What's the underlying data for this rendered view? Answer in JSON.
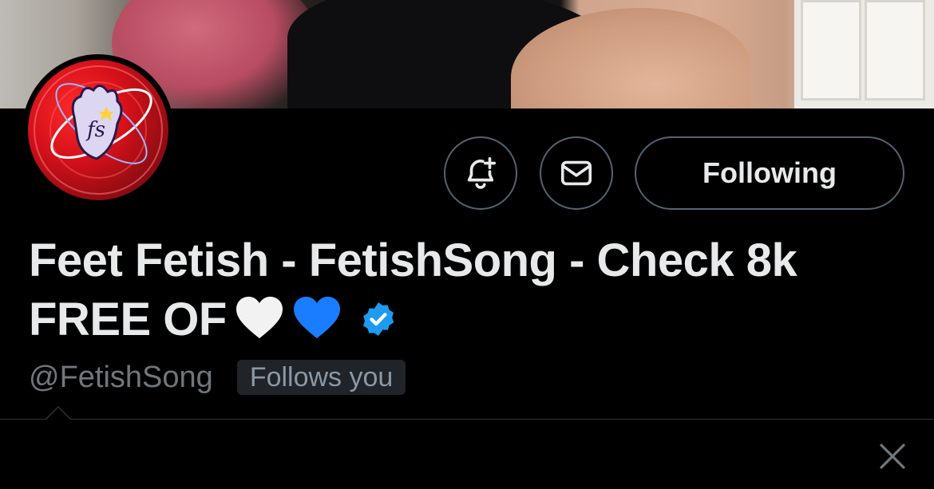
{
  "profile": {
    "banner_icon": "banner-photo",
    "avatar_icon": "fs-logo-avatar",
    "name_line1": "Feet Fetish - FetishSong - Check 8k",
    "name_line2": "FREE OF",
    "emoji": [
      "white-heart",
      "blue-heart"
    ],
    "verified_icon": "verified-badge-icon",
    "handle": "@FetishSong",
    "follows_you": "Follows you"
  },
  "actions": {
    "notify_icon": "bell-plus-icon",
    "message_icon": "envelope-icon",
    "follow_label": "Following"
  },
  "popup": {
    "close_icon": "close-icon"
  },
  "colors": {
    "background": "#000000",
    "text_primary": "#e7e9ea",
    "text_secondary": "#71767b",
    "border": "#536471",
    "verified_blue": "#1d9bf0",
    "badge_bg": "#202327"
  }
}
